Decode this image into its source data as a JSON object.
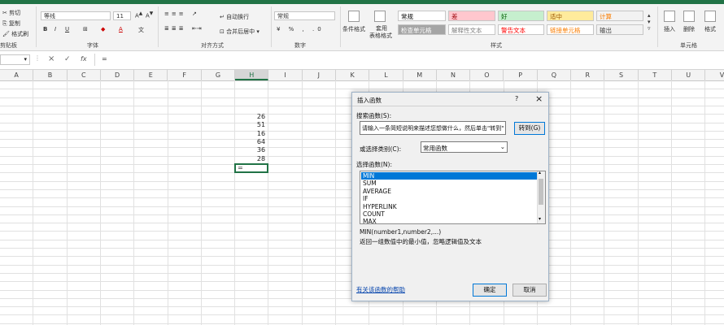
{
  "colors": {
    "accent": "#217346",
    "selection": "#0078d7",
    "cursor_highlight": "#ffea00"
  },
  "ribbon": {
    "clipboard": {
      "cut": "剪切",
      "copy": "复制",
      "format_painter": "格式刷",
      "group_label": "剪贴板"
    },
    "font": {
      "name": "等线",
      "size": "11",
      "group_label": "字体",
      "bold": "B",
      "italic": "I",
      "underline": "U",
      "font_color_icon": "A"
    },
    "alignment": {
      "wrap_text": "自动换行",
      "merge_center": "合并后居中",
      "group_label": "对齐方式"
    },
    "number": {
      "format": "常规",
      "group_label": "数字"
    },
    "styles": {
      "conditional_format": "条件格式",
      "format_as_table_line1": "套用",
      "format_as_table_line2": "表格格式",
      "cells": [
        {
          "label": "常规",
          "bg": "#ffffff",
          "fg": "#000000"
        },
        {
          "label": "差",
          "bg": "#ffc7ce",
          "fg": "#9c0006"
        },
        {
          "label": "好",
          "bg": "#c6efce",
          "fg": "#006100"
        },
        {
          "label": "适中",
          "bg": "#ffeb9c",
          "fg": "#9c5700"
        },
        {
          "label": "计算",
          "bg": "#f2f2f2",
          "fg": "#fa7d00"
        },
        {
          "label": "检查单元格",
          "bg": "#a5a5a5",
          "fg": "#ffffff"
        },
        {
          "label": "解释性文本",
          "bg": "#ffffff",
          "fg": "#7f7f7f"
        },
        {
          "label": "警告文本",
          "bg": "#ffffff",
          "fg": "#ff0000"
        },
        {
          "label": "链接单元格",
          "bg": "#ffffff",
          "fg": "#fa7d00"
        },
        {
          "label": "输出",
          "bg": "#f2f2f2",
          "fg": "#3f3f3f"
        }
      ],
      "group_label": "样式"
    },
    "cells": {
      "insert": "插入",
      "delete": "删除",
      "format": "格式",
      "group_label": "单元格"
    }
  },
  "formula_bar": {
    "name_box": "",
    "cancel_icon": "×",
    "enter_icon": "✓",
    "fx": "fx",
    "formula": "="
  },
  "columns": [
    "A",
    "B",
    "C",
    "D",
    "E",
    "F",
    "G",
    "H",
    "I",
    "J",
    "K",
    "L",
    "M",
    "N",
    "O",
    "P",
    "Q",
    "R",
    "S",
    "T",
    "U",
    "V"
  ],
  "cells_h": [
    "26",
    "51",
    "16",
    "64",
    "36",
    "28"
  ],
  "active_cell": "=",
  "dialog": {
    "title": "插入函数",
    "help": "?",
    "close": "×",
    "search_label": "搜索函数(S):",
    "search_value": "请输入一条简短说明来描述您想做什么，然后单击\"转到\"",
    "go_button": "转到(G)",
    "category_label": "或选择类别(C):",
    "category_value": "常用函数",
    "select_label": "选择函数(N):",
    "functions": [
      "MIN",
      "SUM",
      "AVERAGE",
      "IF",
      "HYPERLINK",
      "COUNT",
      "MAX"
    ],
    "signature": "MIN(number1,number2,...)",
    "description": "返回一组数值中的最小值，忽略逻辑值及文本",
    "help_link": "有关该函数的帮助",
    "ok": "确定",
    "cancel": "取消"
  }
}
